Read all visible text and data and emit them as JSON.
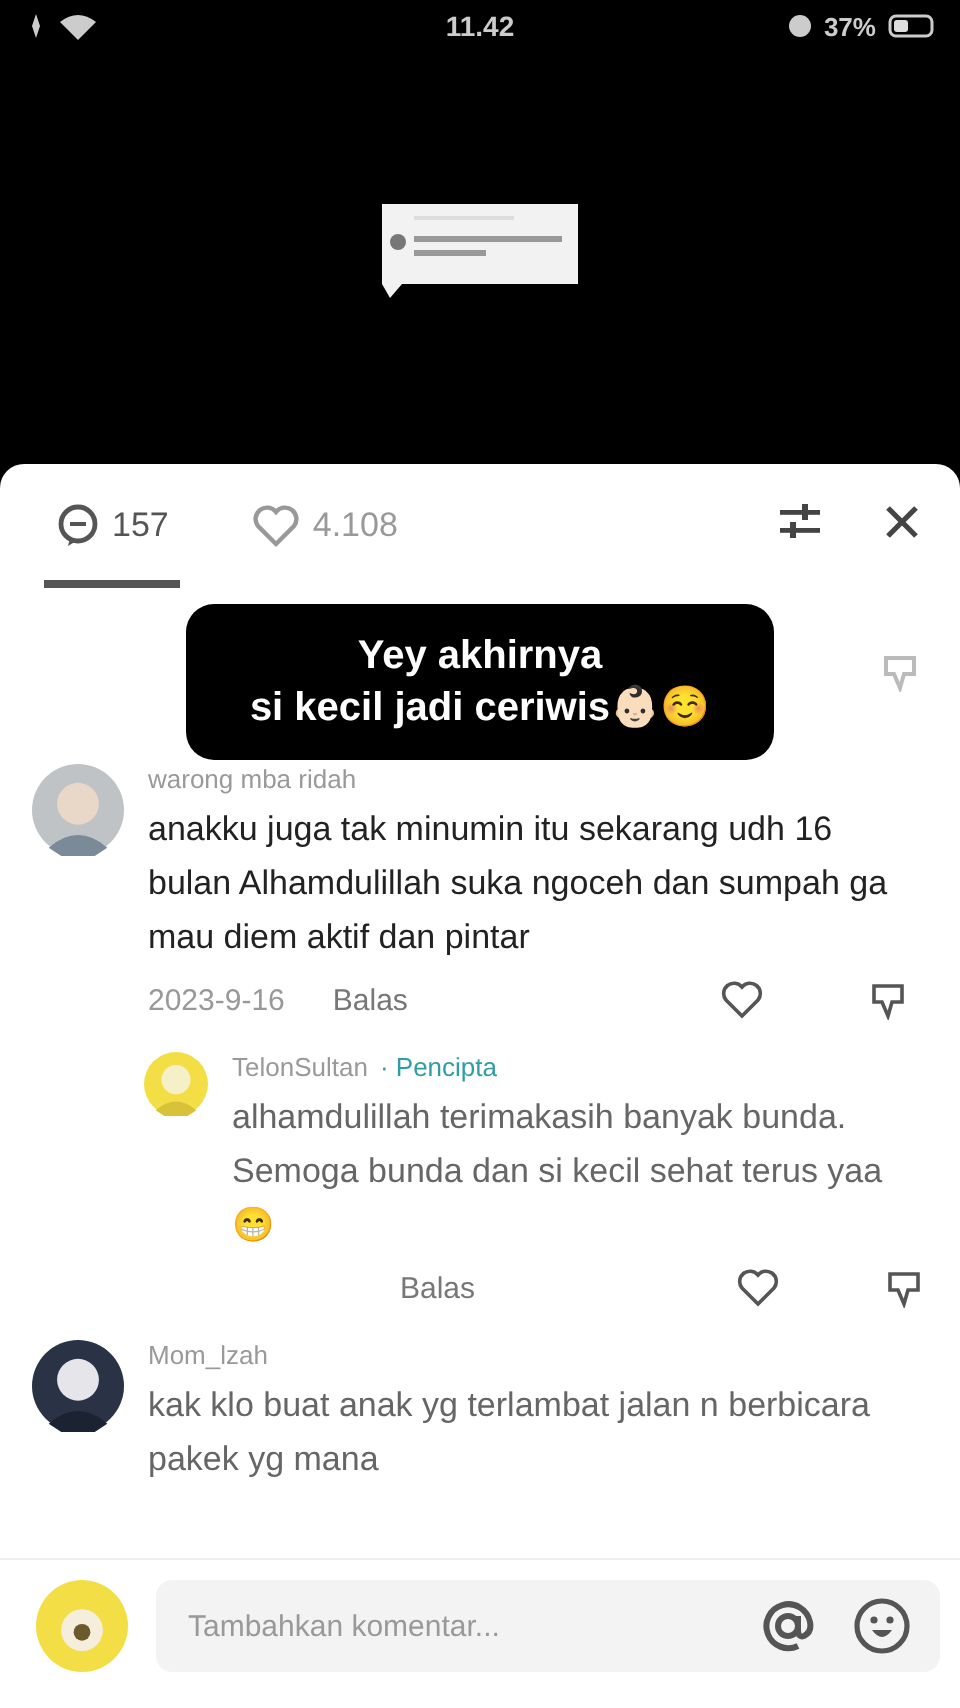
{
  "status_bar": {
    "time": "11.42",
    "battery": "37%"
  },
  "header": {
    "tabs": [
      {
        "label": "157",
        "kind": "comments",
        "selected": true
      },
      {
        "label": "4.108",
        "kind": "likes",
        "selected": false
      }
    ]
  },
  "caption": {
    "lines": [
      "Yey akhirnya",
      "si kecil jadi ceriwis👶🏻☺️"
    ]
  },
  "comments": [
    {
      "kind": "comment",
      "username": "warong mba ridah",
      "text": "anakku juga tak minumin itu sekarang udh 16 bulan Alhamdulillah suka ngoceh dan sumpah ga mau diem aktif dan pintar",
      "date": "2023-9-16",
      "reply": "Balas"
    },
    {
      "kind": "reply",
      "username": "TelonSultan",
      "badge": "· Pencipta",
      "text": "alhamdulillah terimakasih banyak bunda. Semoga bunda dan si kecil sehat terus yaa 😁",
      "reply": "Balas"
    },
    {
      "kind": "comment",
      "username": "Mom_lzah",
      "text": "kak klo buat anak yg terlambat jalan n berbicara pakek yg mana"
    }
  ],
  "composer": {
    "placeholder": "Tambahkan komentar..."
  }
}
